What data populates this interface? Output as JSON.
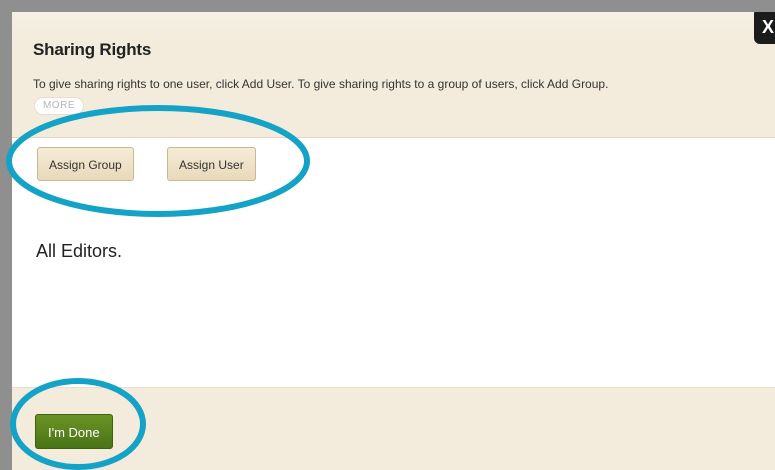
{
  "dialog": {
    "title": "Sharing Rights",
    "description": "To give sharing rights to one user, click Add User. To give sharing rights to a group of users, click Add Group.",
    "more_label": "MORE",
    "close_label": "X"
  },
  "toolbar": {
    "assign_group_label": "Assign Group",
    "assign_user_label": "Assign User"
  },
  "content": {
    "text": "All Editors."
  },
  "footer": {
    "done_label": "I'm Done"
  },
  "colors": {
    "header_bg": "#f3ecdd",
    "done_button": "#5a8420",
    "annotation_ring": "#14a3c7"
  }
}
